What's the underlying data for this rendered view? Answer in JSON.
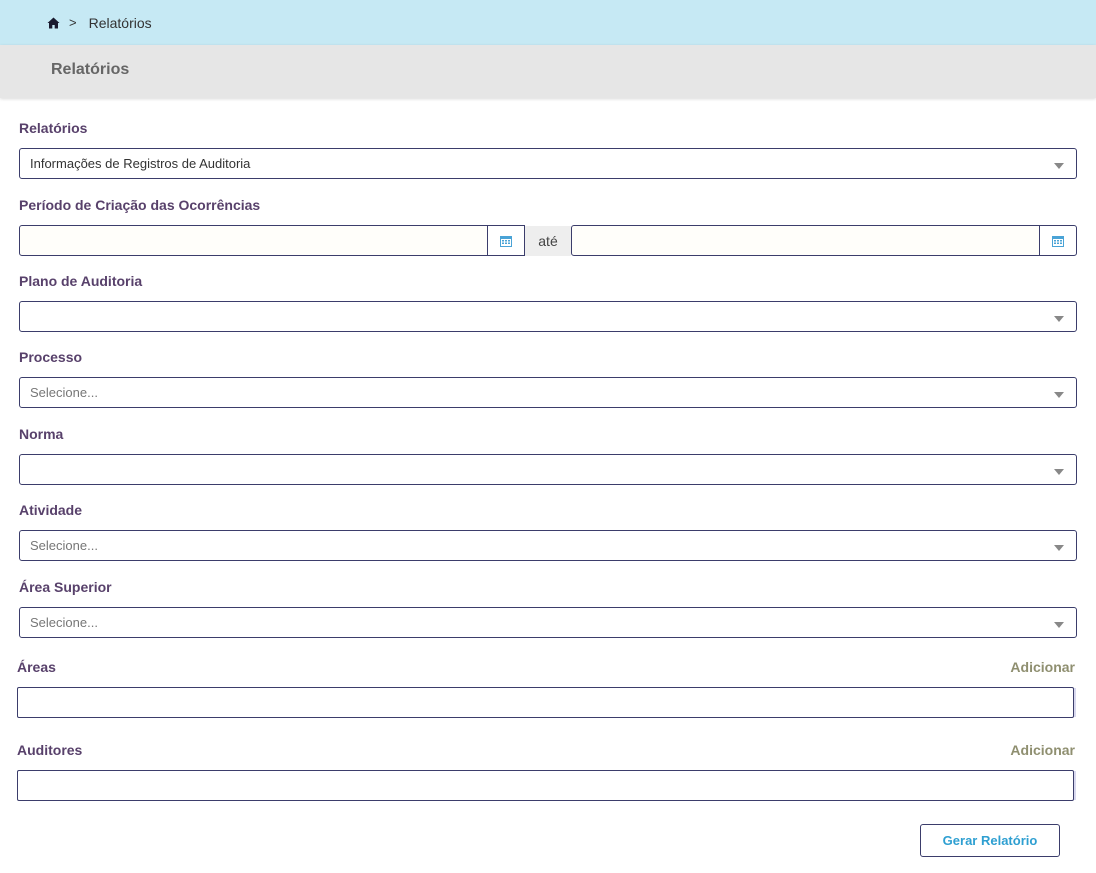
{
  "breadcrumb": {
    "current": "Relatórios",
    "separator": ">"
  },
  "page_title": "Relatórios",
  "form": {
    "relatorios": {
      "label": "Relatórios",
      "value": "Informações de Registros de Auditoria"
    },
    "periodo": {
      "label": "Período de Criação das Ocorrências",
      "separator": "até",
      "start": "",
      "end": ""
    },
    "plano": {
      "label": "Plano de Auditoria",
      "value": ""
    },
    "processo": {
      "label": "Processo",
      "placeholder": "Selecione..."
    },
    "norma": {
      "label": "Norma",
      "value": ""
    },
    "atividade": {
      "label": "Atividade",
      "placeholder": "Selecione..."
    },
    "area_superior": {
      "label": "Área Superior",
      "placeholder": "Selecione..."
    },
    "areas": {
      "label": "Áreas",
      "add_label": "Adicionar"
    },
    "auditores": {
      "label": "Auditores",
      "add_label": "Adicionar"
    },
    "submit_label": "Gerar Relatório"
  },
  "colors": {
    "breadcrumb_bg": "#c6e9f4",
    "header_bg": "#e6e6e6",
    "label": "#58416b",
    "border": "#3b3d6b",
    "button_text": "#2e9fd1",
    "add_link": "#8f8f70"
  },
  "icons": [
    "home-icon",
    "calendar-icon",
    "chevron-down-icon"
  ]
}
